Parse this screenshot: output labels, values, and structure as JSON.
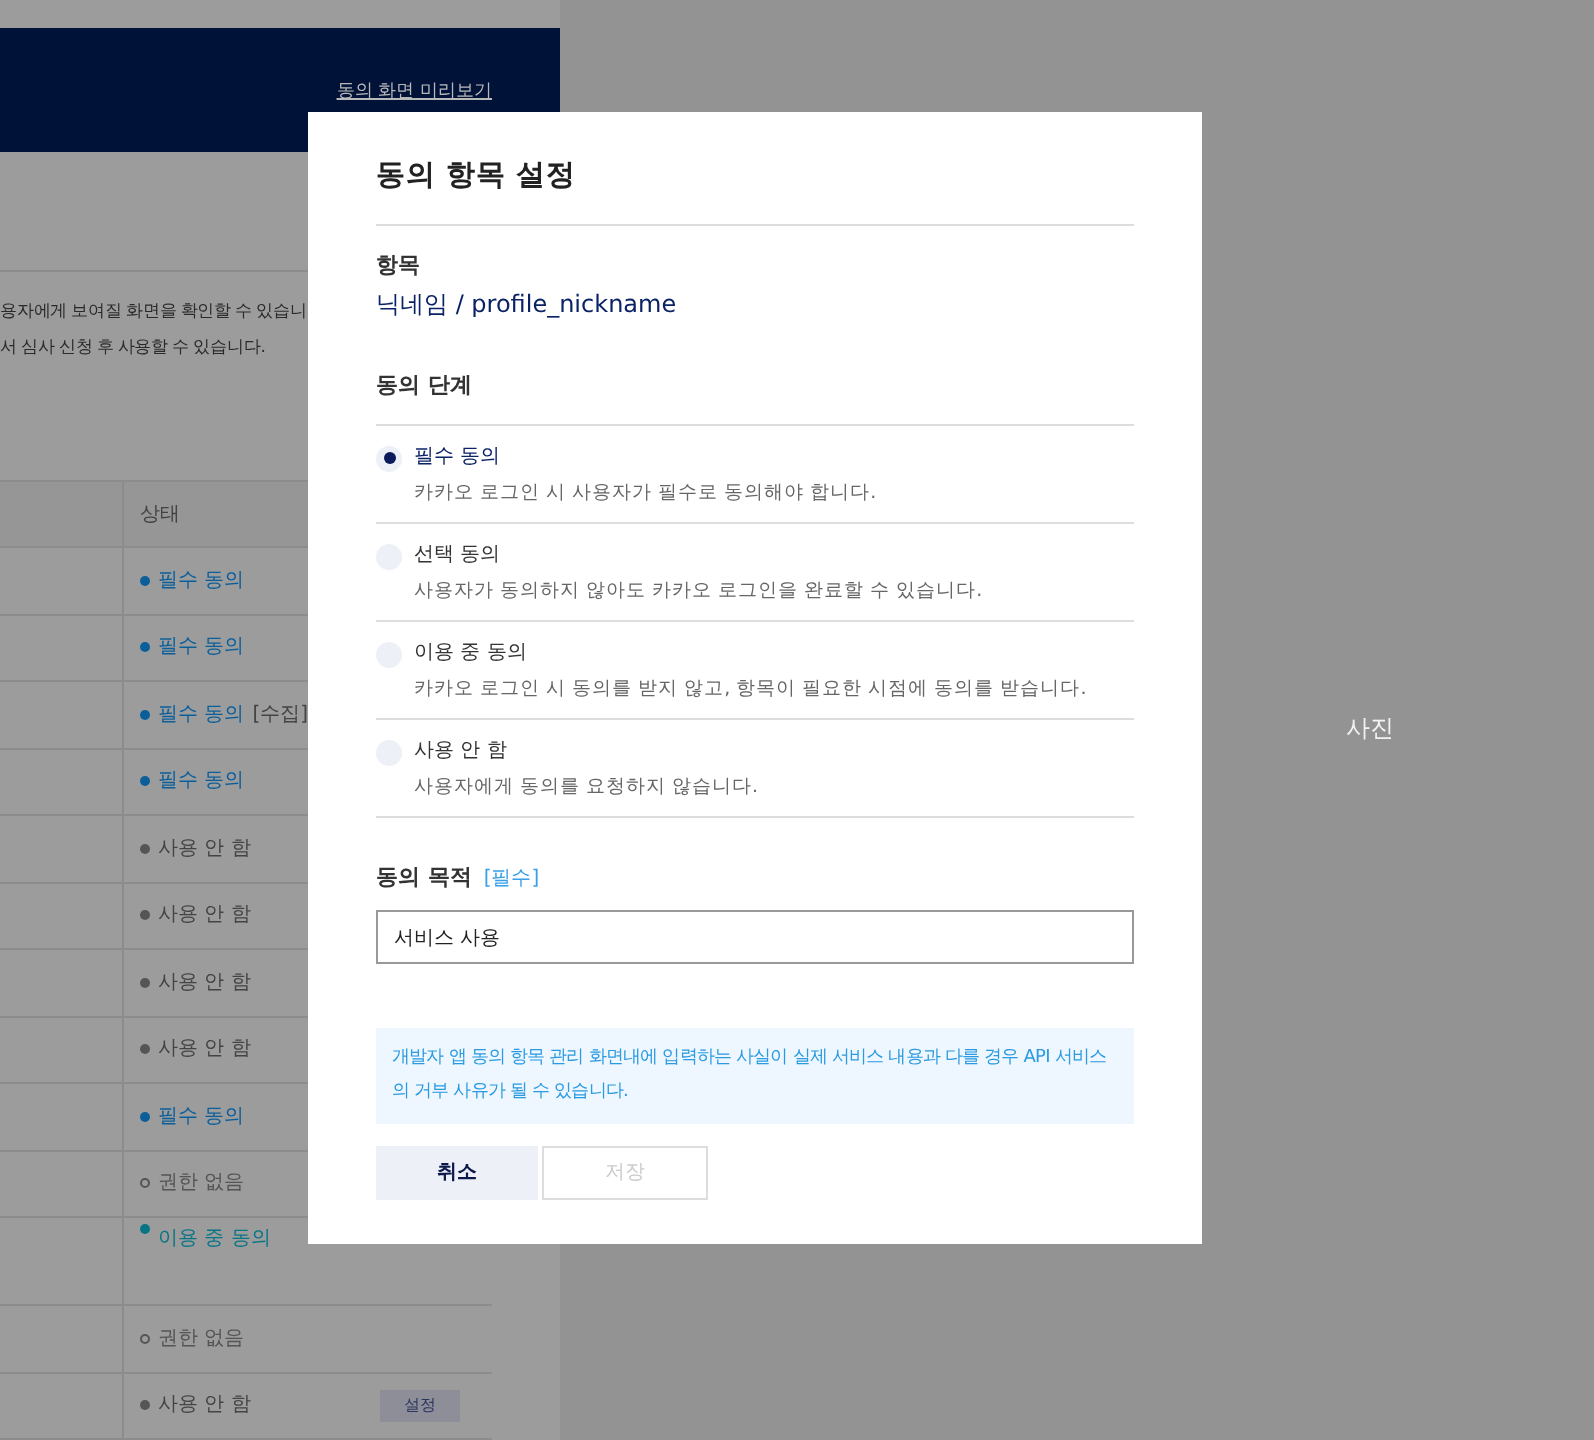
{
  "header": {
    "link": "동의 화면 미리보기"
  },
  "intro": [
    "용자에게 보여질 화면을 확인할 수 있습니",
    "서 심사 신청 후 사용할 수 있습니다."
  ],
  "table": {
    "columns": [
      "상태"
    ],
    "rows": [
      {
        "status": "필수 동의",
        "kind": "required"
      },
      {
        "status": "필수 동의",
        "kind": "required"
      },
      {
        "status": "필수 동의",
        "kind": "required",
        "note": "[수집]"
      },
      {
        "status": "필수 동의",
        "kind": "required"
      },
      {
        "status": "사용 안 함",
        "kind": "unused"
      },
      {
        "status": "사용 안 함",
        "kind": "unused"
      },
      {
        "status": "사용 안 함",
        "kind": "unused"
      },
      {
        "status": "사용 안 함",
        "kind": "unused"
      },
      {
        "status": "필수 동의",
        "kind": "required"
      },
      {
        "status": "권한 없음",
        "kind": "denied"
      },
      {
        "status": "이용 중 동의",
        "kind": "inuse"
      },
      {
        "status": "권한 없음",
        "kind": "denied"
      },
      {
        "status": "사용 안 함",
        "kind": "unused",
        "button": "설정"
      }
    ]
  },
  "photo": {
    "label": "사진"
  },
  "dialog": {
    "title": "동의 항목 설정",
    "item_label": "항목",
    "item_value": "닉네임 / profile_nickname",
    "level_label": "동의 단계",
    "options": [
      {
        "label": "필수 동의",
        "description": "카카오 로그인 시 사용자가 필수로 동의해야 합니다.",
        "selected": true
      },
      {
        "label": "선택 동의",
        "description": "사용자가 동의하지 않아도 카카오 로그인을 완료할 수 있습니다.",
        "selected": false
      },
      {
        "label": "이용 중 동의",
        "description": "카카오 로그인 시 동의를 받지 않고, 항목이 필요한 시점에 동의를 받습니다.",
        "selected": false
      },
      {
        "label": "사용 안 함",
        "description": "사용자에게 동의를 요청하지 않습니다.",
        "selected": false
      }
    ],
    "purpose_label": "동의 목적",
    "purpose_required": "[필수]",
    "purpose_value": "서비스 사용",
    "notice": "개발자 앱 동의 항목 관리 화면내에 입력하는 사실이 실제 서비스 내용과 다를 경우 API 서비스의 거부 사유가 될 수 있습니다.",
    "cancel": "취소",
    "save": {
      "label": "저장",
      "disabled": true
    }
  }
}
